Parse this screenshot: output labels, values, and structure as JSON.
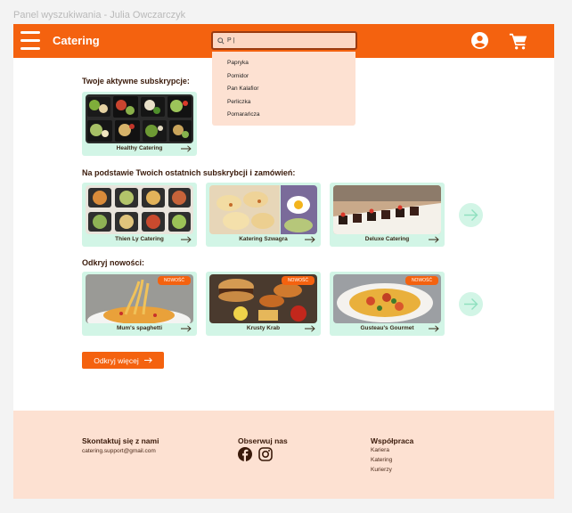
{
  "frame_title": "Panel wyszukiwania - Julia Owczarczyk",
  "header": {
    "brand": "Catering",
    "search_value": "P |",
    "suggestions": [
      "Papryka",
      "Pomidor",
      "Pan Kalafior",
      "Perliczka",
      "Pomarańcza"
    ]
  },
  "sections": {
    "active_title": "Twoje aktywne subskrypcje:",
    "recommended_title": "Na podstawie Twoich ostatnich subskrybcji i zamówień:",
    "new_title": "Odkryj nowości:"
  },
  "cards": {
    "active": [
      {
        "label": "Healthy Catering"
      }
    ],
    "recommended": [
      {
        "label": "Thien Ly Catering"
      },
      {
        "label": "Katering Szwagra"
      },
      {
        "label": "Deluxe Catering"
      }
    ],
    "new": [
      {
        "label": "Mum's spaghetti",
        "badge": "NOWOŚĆ"
      },
      {
        "label": "Krusty Krab",
        "badge": "NOWOŚĆ"
      },
      {
        "label": "Gusteau's Gourmet",
        "badge": "NOWOŚĆ"
      }
    ]
  },
  "more_button": "Odkryj więcej",
  "footer": {
    "contact_title": "Skontaktuj się z nami",
    "contact_email": "catering.support@gmail.com",
    "follow_title": "Obserwuj nas",
    "collab_title": "Współpraca",
    "collab_links": [
      "Kariera",
      "Katering",
      "Kurierzy"
    ]
  },
  "colors": {
    "primary": "#f4620f",
    "card_bg": "#d2f5e6",
    "dropdown_bg": "#fde1d2",
    "footer_bg": "#fde1d2"
  },
  "icons": [
    "menu-icon",
    "search-icon",
    "user-icon",
    "cart-icon",
    "arrow-right-icon",
    "facebook-icon",
    "instagram-icon"
  ]
}
